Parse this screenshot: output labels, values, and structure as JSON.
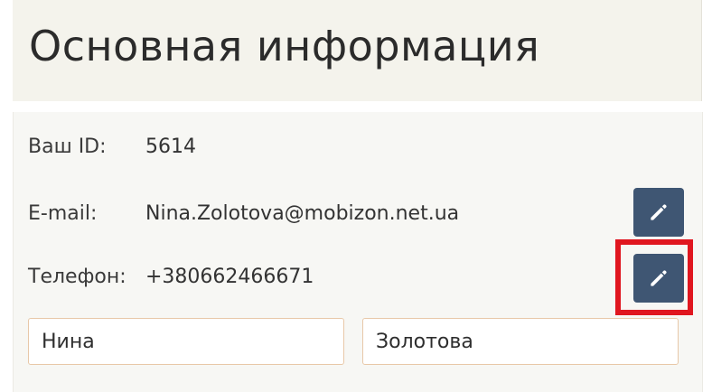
{
  "section": {
    "title": "Основная информация"
  },
  "fields": {
    "id": {
      "label": "Ваш ID:",
      "value": "5614"
    },
    "email": {
      "label": "E-mail:",
      "value": "Nina.Zolotova@mobizon.net.ua"
    },
    "phone": {
      "label": "Телефон:",
      "value": "+380662466671"
    }
  },
  "inputs": {
    "first_name": {
      "value": "Нина"
    },
    "last_name": {
      "value": "Золотова"
    }
  },
  "icons": {
    "edit": "pencil-icon"
  },
  "colors": {
    "header_bg": "#f4f3ec",
    "body_bg": "#f7f7f4",
    "edit_button": "#3f5673",
    "highlight": "#e0161f",
    "input_border": "#e8c8a8"
  }
}
